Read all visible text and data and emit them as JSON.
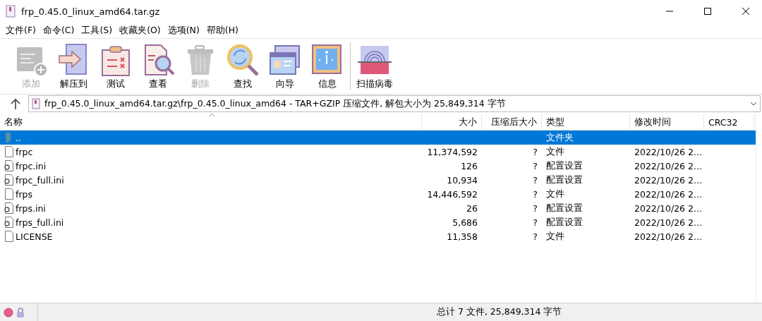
{
  "window": {
    "title": "frp_0.45.0_linux_amd64.tar.gz"
  },
  "menu": [
    "文件(F)",
    "命令(C)",
    "工具(S)",
    "收藏夹(O)",
    "选项(N)",
    "帮助(H)"
  ],
  "toolbar": [
    {
      "kind": "add",
      "label": "添加",
      "disabled": true
    },
    {
      "kind": "extract",
      "label": "解压到",
      "disabled": false
    },
    {
      "kind": "test",
      "label": "测试",
      "disabled": false
    },
    {
      "kind": "view",
      "label": "查看",
      "disabled": false
    },
    {
      "kind": "delete",
      "label": "删除",
      "disabled": true
    },
    {
      "kind": "find",
      "label": "查找",
      "disabled": false
    },
    {
      "kind": "wizard",
      "label": "向导",
      "disabled": false
    },
    {
      "kind": "info",
      "label": "信息",
      "disabled": false
    },
    {
      "kind": "scan",
      "label": "扫描病毒",
      "disabled": false
    }
  ],
  "address": {
    "path": "frp_0.45.0_linux_amd64.tar.gz\\frp_0.45.0_linux_amd64 - TAR+GZIP 压缩文件, 解包大小为 25,849,314 字节"
  },
  "table": {
    "columns": [
      "名称",
      "大小",
      "压缩后大小",
      "类型",
      "修改时间",
      "CRC32"
    ],
    "rows": [
      {
        "kind": "folder",
        "name": "..",
        "type": "文件夹",
        "selected": true
      },
      {
        "kind": "file",
        "name": "frpc",
        "size": "11,374,592",
        "packed": "?",
        "type": "文件",
        "modified": "2022/10/26 2...",
        "selected": false
      },
      {
        "kind": "config",
        "name": "frpc.ini",
        "size": "126",
        "packed": "?",
        "type": "配置设置",
        "modified": "2022/10/26 2...",
        "selected": false
      },
      {
        "kind": "config",
        "name": "frpc_full.ini",
        "size": "10,934",
        "packed": "?",
        "type": "配置设置",
        "modified": "2022/10/26 2...",
        "selected": false
      },
      {
        "kind": "file",
        "name": "frps",
        "size": "14,446,592",
        "packed": "?",
        "type": "文件",
        "modified": "2022/10/26 2...",
        "selected": false
      },
      {
        "kind": "config",
        "name": "frps.ini",
        "size": "26",
        "packed": "?",
        "type": "配置设置",
        "modified": "2022/10/26 2...",
        "selected": false
      },
      {
        "kind": "config",
        "name": "frps_full.ini",
        "size": "5,686",
        "packed": "?",
        "type": "配置设置",
        "modified": "2022/10/26 2...",
        "selected": false
      },
      {
        "kind": "file",
        "name": "LICENSE",
        "size": "11,358",
        "packed": "?",
        "type": "文件",
        "modified": "2022/10/26 2...",
        "selected": false
      }
    ]
  },
  "status_bar": {
    "text": "总计 7 文件, 25,849,314 字节"
  }
}
